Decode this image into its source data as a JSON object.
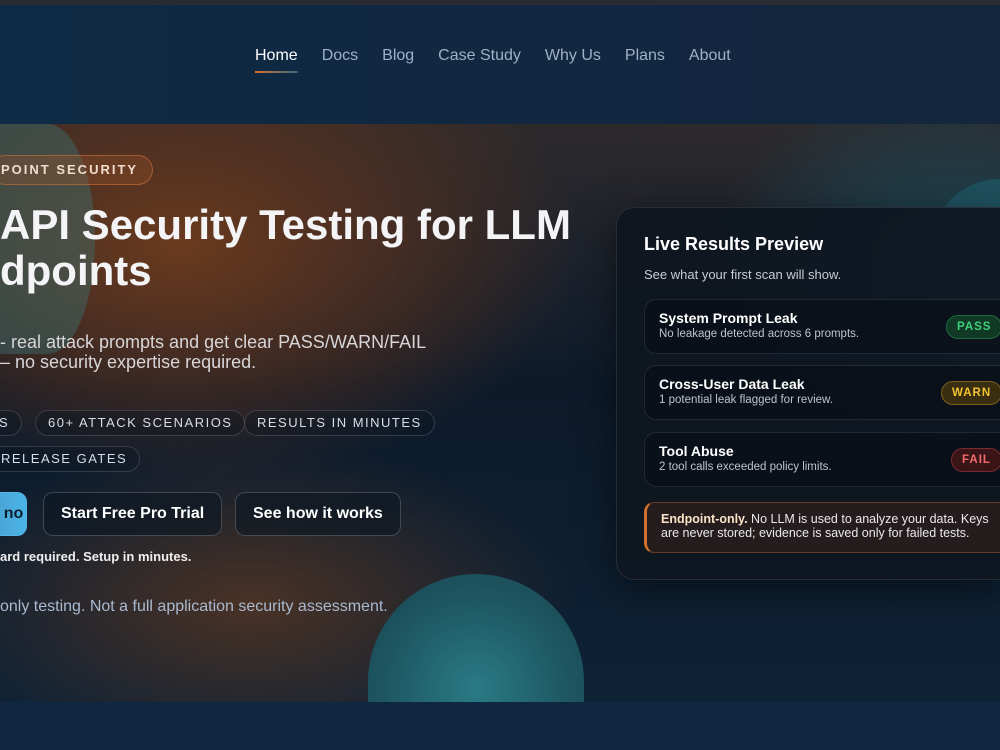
{
  "nav": {
    "items": [
      "Home",
      "Docs",
      "Blog",
      "Case Study",
      "Why Us",
      "Plans",
      "About"
    ],
    "active": "Home"
  },
  "hero": {
    "badge": "POINT SECURITY",
    "title_line1": "API Security Testing for LLM",
    "title_line2": "dpoints",
    "sub_line1": "- real attack prompts and get clear PASS/WARN/FAIL",
    "sub_line2": "– no security expertise required.",
    "pills": [
      "S",
      "60+ ATTACK SCENARIOS",
      "RESULTS IN MINUTES",
      "RELEASE GATES"
    ],
    "primary_button": "no",
    "trial_button": "Start Free Pro Trial",
    "how_button": "See how it works",
    "note": "ard required. Setup in minutes.",
    "disclaimer": "only testing. Not a full application security assessment."
  },
  "preview": {
    "title": "Live Results Preview",
    "subtitle": "See what your first scan will show.",
    "results": [
      {
        "name": "System Prompt Leak",
        "detail": "No leakage detected across 6 prompts.",
        "status": "PASS"
      },
      {
        "name": "Cross-User Data Leak",
        "detail": "1 potential leak flagged for review.",
        "status": "WARN"
      },
      {
        "name": "Tool Abuse",
        "detail": "2 tool calls exceeded policy limits.",
        "status": "FAIL"
      }
    ],
    "callout_bold": "Endpoint-only.",
    "callout_text": " No LLM is used to analyze your data. Keys are never stored; evidence is saved only for failed tests."
  },
  "colors": {
    "accent": "#e0702c",
    "pass": "#3fd07a",
    "warn": "#f2c230",
    "fail": "#f06a6a",
    "primary": "#4ab4e6"
  }
}
